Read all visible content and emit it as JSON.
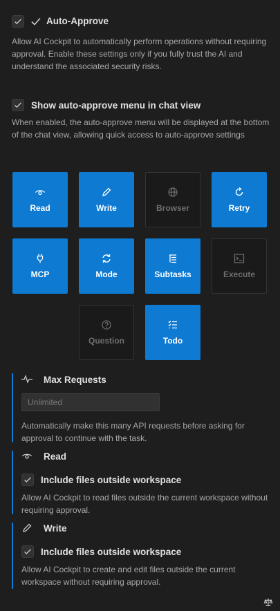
{
  "auto_approve": {
    "title": "Auto-Approve",
    "description": "Allow AI Cockpit to automatically perform operations without requiring approval. Enable these settings only if you fully trust the AI and understand the associated security risks."
  },
  "show_menu": {
    "label": "Show auto-approve menu in chat view",
    "description": "When enabled, the auto-approve menu will be displayed at the bottom of the chat view, allowing quick access to auto-approve settings"
  },
  "tiles": [
    {
      "label": "Read",
      "icon": "eye-icon",
      "enabled": true
    },
    {
      "label": "Write",
      "icon": "pencil-icon",
      "enabled": true
    },
    {
      "label": "Browser",
      "icon": "globe-icon",
      "enabled": false
    },
    {
      "label": "Retry",
      "icon": "refresh-icon",
      "enabled": true
    },
    {
      "label": "MCP",
      "icon": "plug-icon",
      "enabled": true
    },
    {
      "label": "Mode",
      "icon": "sync-icon",
      "enabled": true
    },
    {
      "label": "Subtasks",
      "icon": "list-tree-icon",
      "enabled": true
    },
    {
      "label": "Execute",
      "icon": "terminal-icon",
      "enabled": false
    },
    {
      "label": "Question",
      "icon": "question-icon",
      "enabled": false
    },
    {
      "label": "Todo",
      "icon": "checklist-icon",
      "enabled": true
    }
  ],
  "max_requests": {
    "title": "Max Requests",
    "placeholder": "Unlimited",
    "description": "Automatically make this many API requests before asking for approval to continue with the task."
  },
  "read_section": {
    "title": "Read",
    "option_label": "Include files outside workspace",
    "option_description": "Allow AI Cockpit to read files outside the current workspace without requiring approval."
  },
  "write_section": {
    "title": "Write",
    "option_label": "Include files outside workspace",
    "option_description": "Allow AI Cockpit to create and edit files outside the current workspace without requiring approval."
  },
  "colors": {
    "accent": "#0e7ad2",
    "background": "#1e1e1e"
  }
}
